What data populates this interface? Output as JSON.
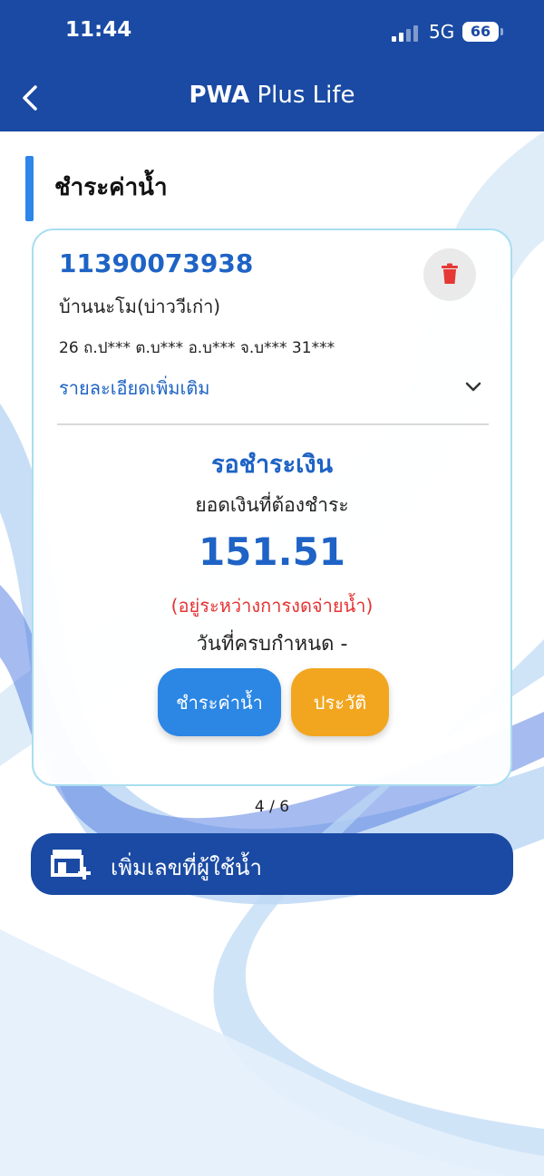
{
  "status_bar": {
    "time": "11:44",
    "network": "5G",
    "battery": "66"
  },
  "header": {
    "title_bold": "PWA",
    "title_rest": " Plus Life"
  },
  "section": {
    "title": "ชำระค่าน้ำ"
  },
  "card": {
    "account_no": "11390073938",
    "place_name": "บ้านนะโม(บ่าววีเก่า)",
    "address": "26 ถ.ป*** ต.บ*** อ.บ*** จ.บ*** 31***",
    "more_details": "รายละเอียดเพิ่มเติม",
    "status": "รอชำระเงิน",
    "amount_label": "ยอดเงินที่ต้องชำระ",
    "amount": "151.51",
    "suspend_note": "(อยู่ระหว่างการงดจ่ายน้ำ)",
    "due_date": "วันที่ครบกำหนด -",
    "pay_button": "ชำระค่าน้ำ",
    "history_button": "ประวัติ"
  },
  "pager": "4 / 6",
  "add_button": {
    "label": "เพิ่มเลขที่ผู้ใช้น้ำ"
  },
  "icons": {
    "back": "chevron-left-icon",
    "delete": "trash-icon",
    "expand": "chevron-down-icon",
    "add": "store-add-icon"
  },
  "colors": {
    "primary": "#1a4aa3",
    "accent_blue": "#1e63c5",
    "pay_button": "#2b86e4",
    "history_button": "#f2a620",
    "warning": "#e53333",
    "delete_icon": "#e53935"
  }
}
